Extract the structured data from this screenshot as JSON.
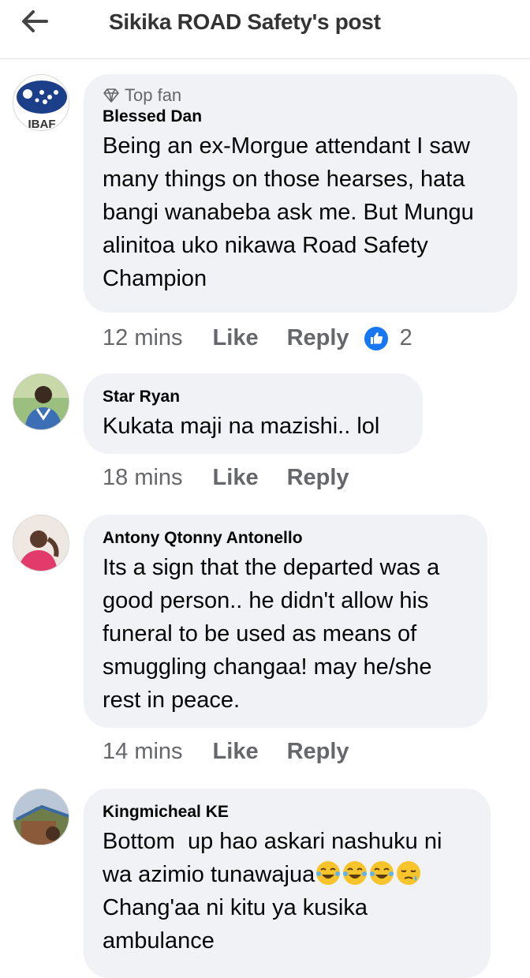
{
  "header": {
    "title": "Sikika ROAD Safety's post"
  },
  "comments": [
    {
      "badge": "Top fan",
      "author": "Blessed Dan",
      "text": "Being an ex-Morgue attendant I saw many things on those hearses, hata bangi wanabeba ask me. But Mungu alinitoa uko nikawa Road Safety Champion",
      "time": "12 mins",
      "like": "Like",
      "reply": "Reply",
      "reaction_count": "2",
      "avatar_text": "IBAF"
    },
    {
      "author": "Star Ryan",
      "text": "Kukata maji na mazishi.. lol",
      "time": "18 mins",
      "like": "Like",
      "reply": "Reply"
    },
    {
      "author": "Antony Qtonny Antonello",
      "text": "Its a sign that the departed was a good person.. he didn't allow his funeral to be used as means of smuggling changaa! may he/she rest in peace.",
      "time": "14 mins",
      "like": "Like",
      "reply": "Reply"
    },
    {
      "author": "Kingmicheal KE",
      "text_line1": "Bottom  up hao askari nashuku ni",
      "text_line2": "wa azimio tunawajua",
      "text_line3": "Chang'aa ni kitu ya kusika ambulance"
    }
  ],
  "colors": {
    "bubble": "#f0f2f5",
    "like_blue": "#1877f2",
    "meta_gray": "#65676b"
  }
}
